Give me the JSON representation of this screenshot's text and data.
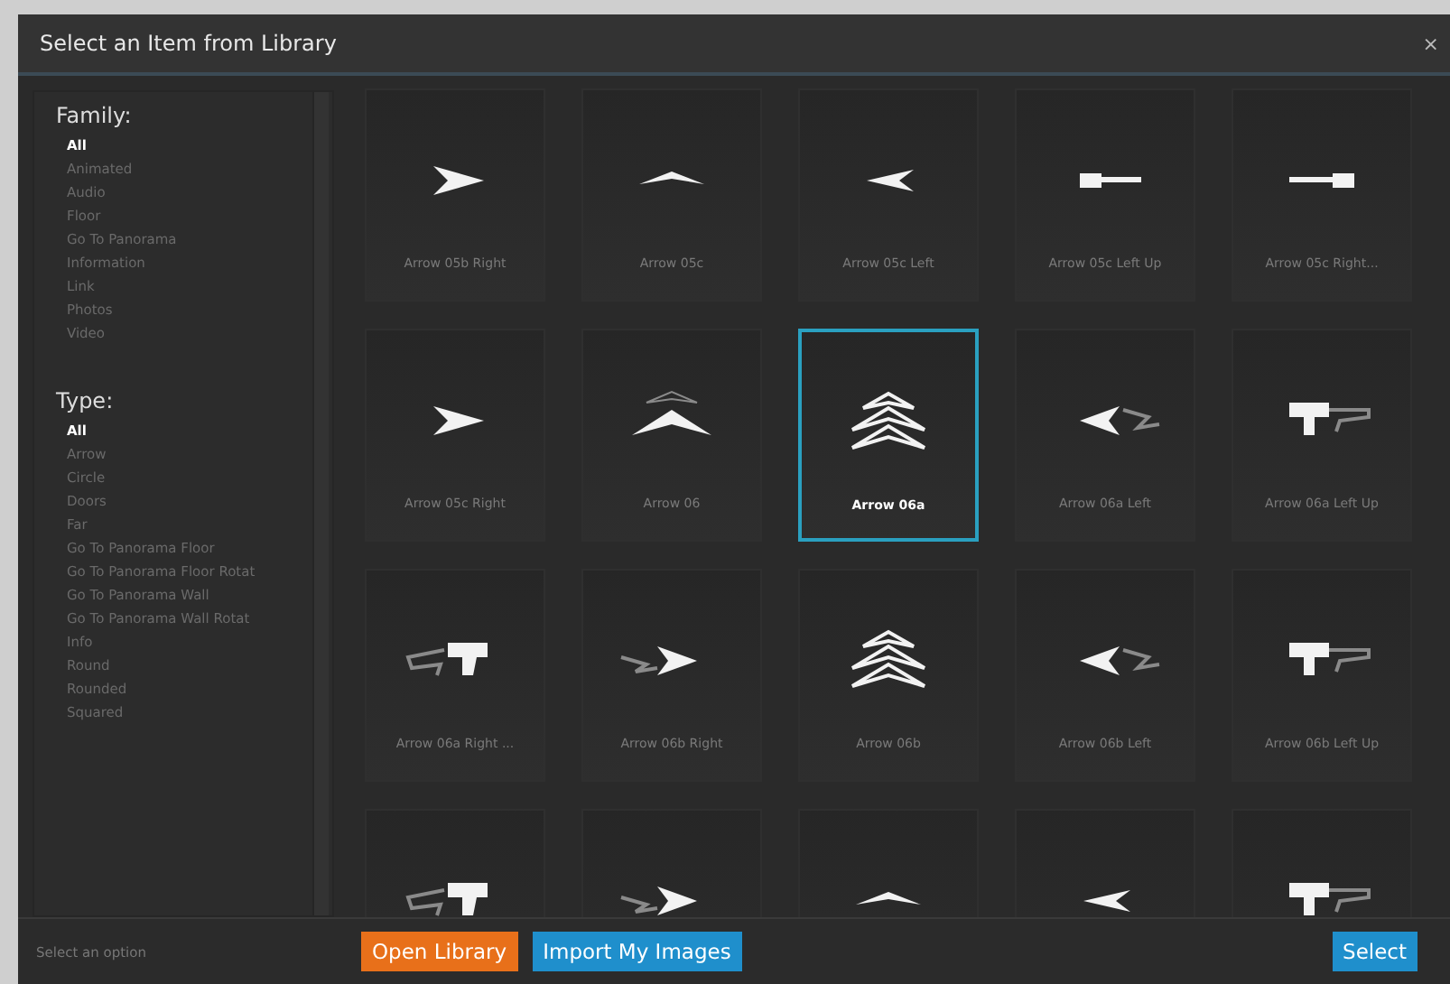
{
  "window": {
    "title": "Select an Item from Library",
    "close": "×"
  },
  "filters": [
    {
      "heading": "Family:",
      "items": [
        {
          "label": "All",
          "selected": true
        },
        {
          "label": "Animated",
          "selected": false
        },
        {
          "label": "Audio",
          "selected": false
        },
        {
          "label": "Floor",
          "selected": false
        },
        {
          "label": "Go To Panorama",
          "selected": false
        },
        {
          "label": "Information",
          "selected": false
        },
        {
          "label": "Link",
          "selected": false
        },
        {
          "label": "Photos",
          "selected": false
        },
        {
          "label": "Video",
          "selected": false
        }
      ]
    },
    {
      "heading": "Type:",
      "items": [
        {
          "label": "All",
          "selected": true
        },
        {
          "label": "Arrow",
          "selected": false
        },
        {
          "label": "Circle",
          "selected": false
        },
        {
          "label": "Doors",
          "selected": false
        },
        {
          "label": "Far",
          "selected": false
        },
        {
          "label": "Go To Panorama Floor",
          "selected": false
        },
        {
          "label": "Go To Panorama Floor Rotat",
          "selected": false
        },
        {
          "label": "Go To Panorama Wall",
          "selected": false
        },
        {
          "label": "Go To Panorama Wall Rotat",
          "selected": false
        },
        {
          "label": "Info",
          "selected": false
        },
        {
          "label": "Round",
          "selected": false
        },
        {
          "label": "Rounded",
          "selected": false
        },
        {
          "label": "Squared",
          "selected": false
        }
      ]
    }
  ],
  "items": [
    {
      "kind": "chevron-right",
      "label": "Arrow 05b Right",
      "selected": false
    },
    {
      "kind": "flat",
      "label": "Arrow 05c",
      "selected": false
    },
    {
      "kind": "chevron-left",
      "label": "Arrow 05c Left",
      "selected": false
    },
    {
      "kind": "bar-left",
      "label": "Arrow 05c Left Up",
      "selected": false
    },
    {
      "kind": "bar-right",
      "label": "Arrow 05c Right...",
      "selected": false
    },
    {
      "kind": "chevron-right",
      "label": "Arrow 05c Right",
      "selected": false
    },
    {
      "kind": "chevron-up",
      "label": "Arrow 06",
      "selected": false
    },
    {
      "kind": "double-up",
      "label": "Arrow 06a",
      "selected": true
    },
    {
      "kind": "trail-left",
      "label": "Arrow 06a Left",
      "selected": false
    },
    {
      "kind": "gun-left",
      "label": "Arrow 06a Left Up",
      "selected": false
    },
    {
      "kind": "gun-right",
      "label": "Arrow 06a Right ...",
      "selected": false
    },
    {
      "kind": "trail-right",
      "label": "Arrow 06b Right",
      "selected": false
    },
    {
      "kind": "double-up",
      "label": "Arrow 06b",
      "selected": false
    },
    {
      "kind": "trail-left",
      "label": "Arrow 06b Left",
      "selected": false
    },
    {
      "kind": "gun-left",
      "label": "Arrow 06b Left Up",
      "selected": false
    },
    {
      "kind": "gun-right",
      "selected": false
    },
    {
      "kind": "trail-right",
      "selected": false
    },
    {
      "kind": "flat",
      "selected": false
    },
    {
      "kind": "chevron-left",
      "selected": false
    },
    {
      "kind": "gun-left",
      "selected": false
    }
  ],
  "footer": {
    "hint": "Select an option",
    "buttons": [
      {
        "label": "Open Library",
        "kind": "orange"
      },
      {
        "label": "Import My Images",
        "kind": "blue"
      },
      {
        "label": "Select",
        "kind": "blue"
      }
    ]
  }
}
